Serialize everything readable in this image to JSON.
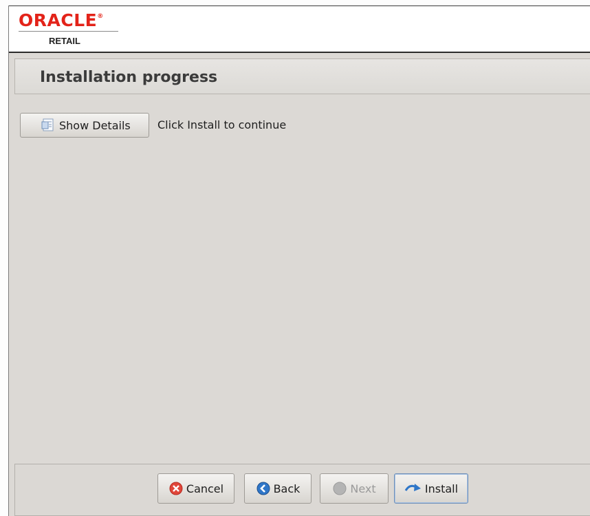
{
  "header": {
    "logo_text": "ORACLE",
    "logo_mark": "®",
    "logo_subtext": "RETAIL"
  },
  "page": {
    "title": "Installation progress",
    "status_text": "Click Install to continue"
  },
  "buttons": {
    "show_details": {
      "label": "Show Details",
      "icon": "document-icon"
    },
    "cancel": {
      "label": "Cancel",
      "icon": "cancel-icon",
      "icon_color": "#e0463a"
    },
    "back": {
      "label": "Back",
      "icon": "back-arrow-icon",
      "icon_color": "#2f76c8"
    },
    "next": {
      "label": "Next",
      "icon": "next-arrow-icon",
      "enabled": false
    },
    "install": {
      "label": "Install",
      "icon": "install-arrow-icon",
      "icon_color": "#2f76c8"
    }
  },
  "colors": {
    "brand": "#e32319",
    "background": "#dcd9d5"
  }
}
